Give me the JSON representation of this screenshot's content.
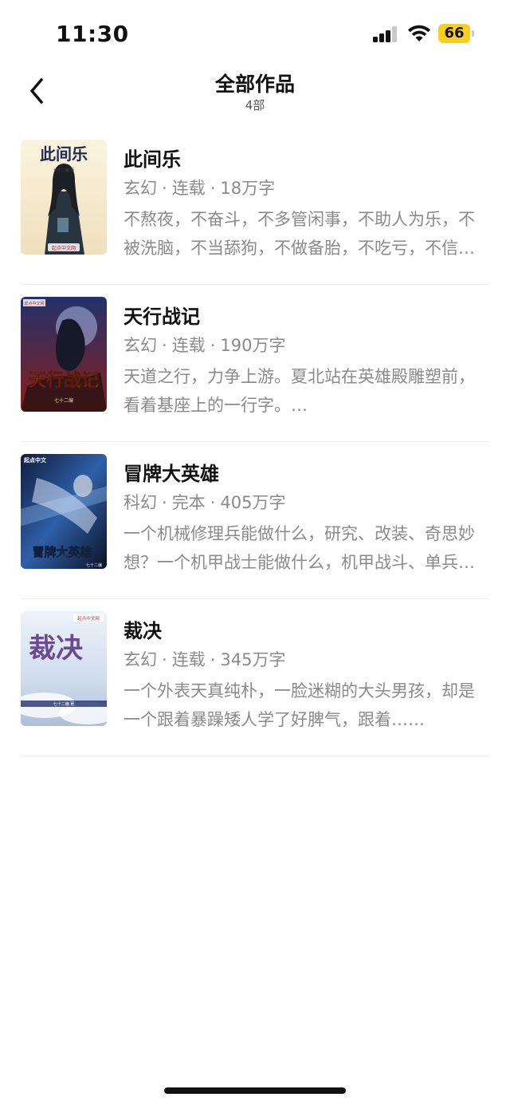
{
  "status": {
    "time": "11:30",
    "battery": "66"
  },
  "nav": {
    "title": "全部作品",
    "subtitle": "4部"
  },
  "books": [
    {
      "title": "此间乐",
      "genre": "玄幻",
      "state": "连载",
      "words": "18万字",
      "desc": "不熬夜，不奋斗，不多管闲事，不助人为乐，不被洗脑，不当舔狗，不做备胎，不吃亏，不信谣，不传谣……",
      "cover": {
        "title": "此间乐",
        "author": "七十二编 著",
        "brand": "起点中文网"
      }
    },
    {
      "title": "天行战记",
      "genre": "玄幻",
      "state": "连载",
      "words": "190万字",
      "desc": "天道之行，力争上游。夏北站在英雄殿雕塑前，看着基座上的一行字。…",
      "cover": {
        "title": "天行战记",
        "author": "七十二编",
        "brand": "起点中文网"
      }
    },
    {
      "title": "冒牌大英雄",
      "genre": "科幻",
      "state": "完本",
      "words": "405万字",
      "desc": "一个机械修理兵能做什么，研究、改装、奇思妙想？一个机甲战士能做什么，机甲战斗、单兵作战……",
      "cover": {
        "title": "冒牌大英雄",
        "author": "七十二编",
        "brand": "起点中文"
      }
    },
    {
      "title": "裁决",
      "genre": "玄幻",
      "state": "连载",
      "words": "345万字",
      "desc": "一个外表天真纯朴，一脸迷糊的大头男孩，却是一个跟着暴躁矮人学了好脾气，跟着……",
      "cover": {
        "title": "裁决",
        "author": "七十二编 著",
        "brand": "起点中文网"
      }
    }
  ]
}
